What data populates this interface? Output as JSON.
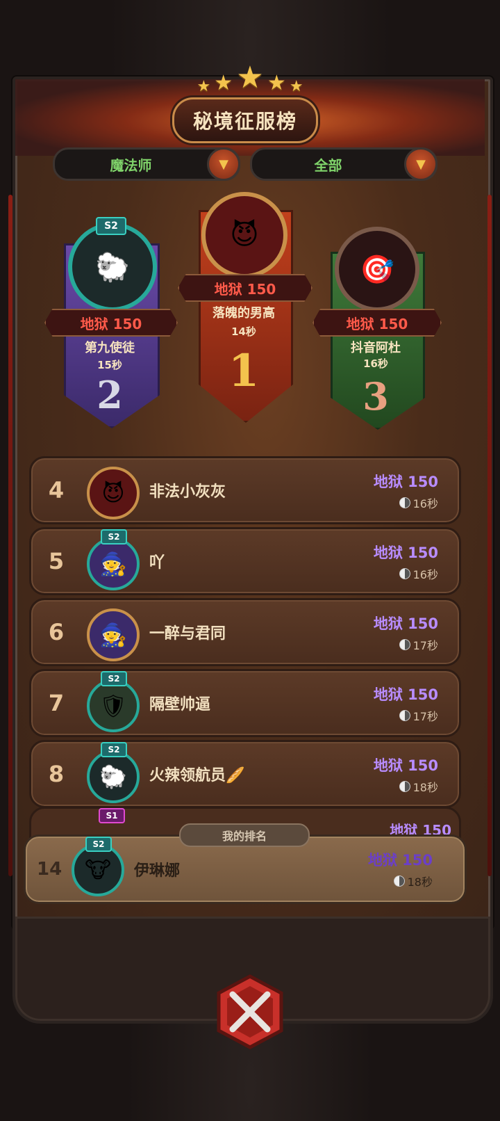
{
  "header": {
    "title": "秘境征服榜",
    "stars": [
      "★",
      "★",
      "★",
      "★",
      "★"
    ]
  },
  "filters": {
    "class_label": "魔法师",
    "scope_label": "全部",
    "arrow_glyph": "▼"
  },
  "podium": [
    {
      "rank": "1",
      "level": "地狱 150",
      "name": "落魄的男高",
      "time": "14秒",
      "avatar": "😈"
    },
    {
      "rank": "2",
      "level": "地狱 150",
      "name": "第九使徒",
      "time": "15秒",
      "avatar": "🐑",
      "season": "S2"
    },
    {
      "rank": "3",
      "level": "地狱 150",
      "name": "抖音阿杜",
      "time": "16秒",
      "avatar": "🎯"
    }
  ],
  "list": [
    {
      "rank": "4",
      "name": "非法小灰灰",
      "level": "地狱 150",
      "time": "16秒",
      "avatar": "😈"
    },
    {
      "rank": "5",
      "name": "吖",
      "level": "地狱 150",
      "time": "16秒",
      "avatar": "🧙",
      "season": "S2"
    },
    {
      "rank": "6",
      "name": "一醉与君同",
      "level": "地狱 150",
      "time": "17秒",
      "avatar": "🧙"
    },
    {
      "rank": "7",
      "name": "隔壁帅逼",
      "level": "地狱 150",
      "time": "17秒",
      "avatar": "🛡",
      "season": "S2"
    },
    {
      "rank": "8",
      "name": "火辣领航员🥖",
      "level": "地狱 150",
      "time": "18秒",
      "avatar": "🐑",
      "season": "S2"
    }
  ],
  "partial_row": {
    "level": "地狱 150",
    "season": "S1"
  },
  "my_rank": {
    "label": "我的排名",
    "rank": "14",
    "name": "伊琳娜",
    "level": "地狱 150",
    "time": "18秒",
    "avatar": "🐮",
    "season": "S2"
  },
  "close_button": {
    "glyph": "✕"
  }
}
